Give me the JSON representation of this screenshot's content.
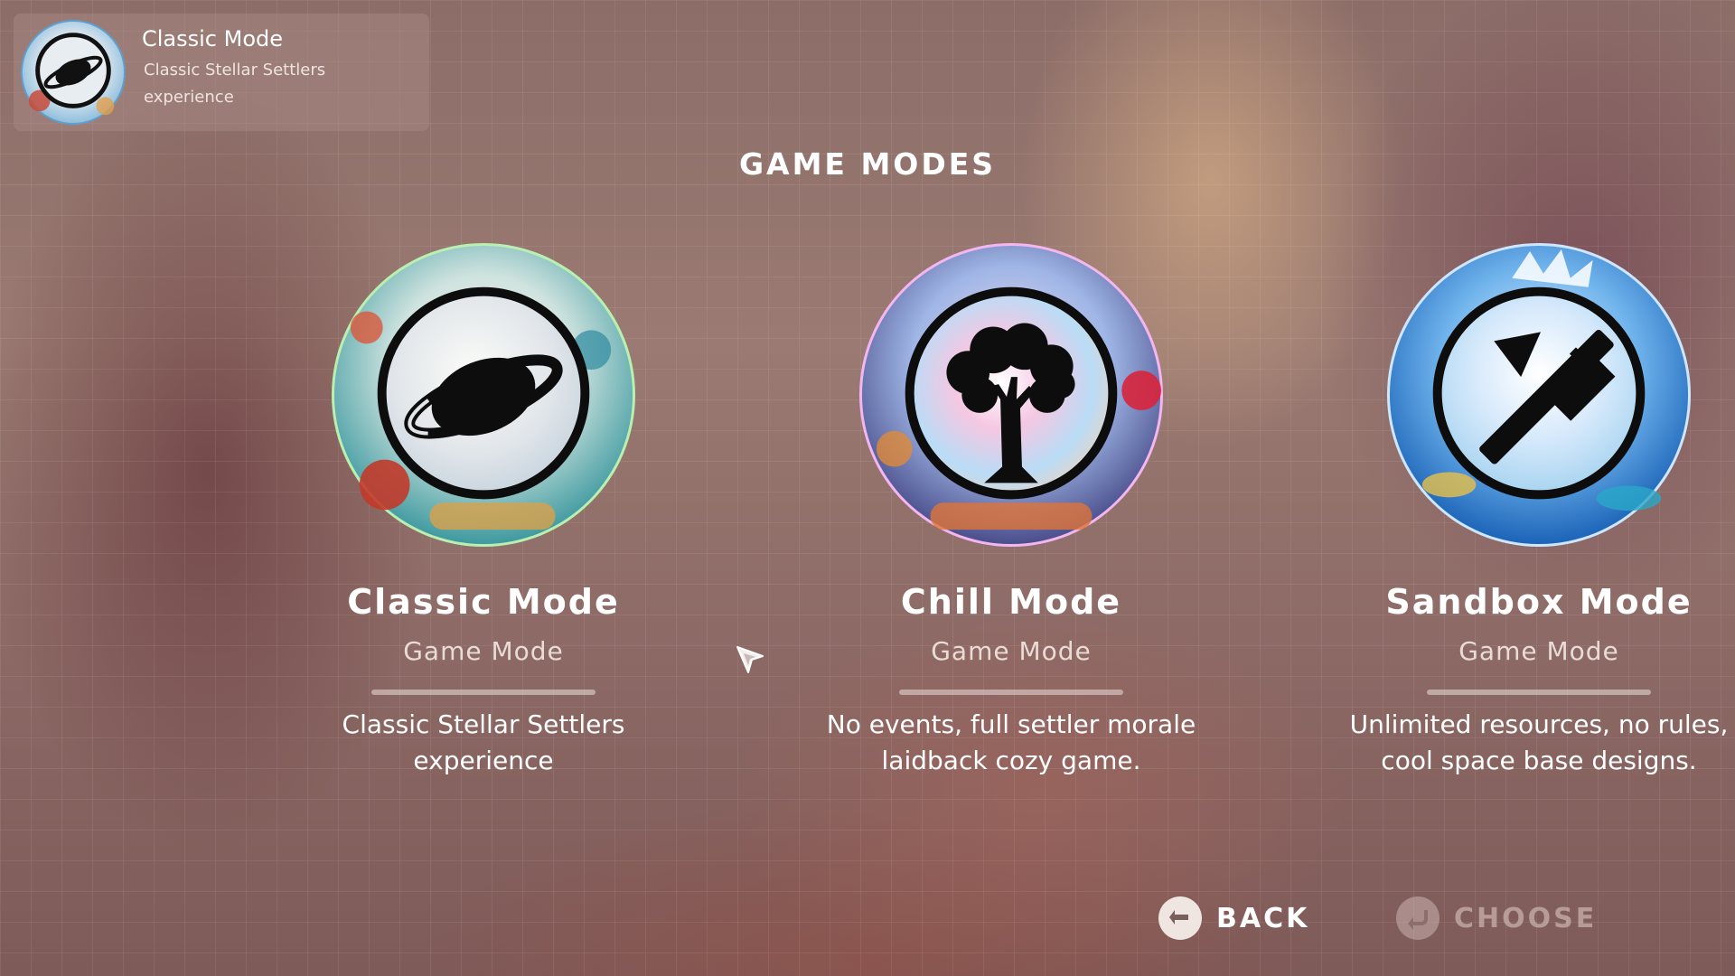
{
  "current_selection": {
    "title": "Classic Mode",
    "description": "Classic Stellar Settlers experience",
    "icon": "planet-icon"
  },
  "screen_title": "GAME MODES",
  "modes": [
    {
      "name": "Classic Mode",
      "type": "Game Mode",
      "description": "Classic Stellar Settlers experience",
      "icon": "planet-icon",
      "ring_color": "#b9f0b0"
    },
    {
      "name": "Chill Mode",
      "type": "Game Mode",
      "description": "No events, full settler morale laidback cozy game.",
      "icon": "tree-icon",
      "ring_color": "#f4b6f0"
    },
    {
      "name": "Sandbox Mode",
      "type": "Game Mode",
      "description": "Unlimited resources, no rules, cool space base designs.",
      "icon": "hammer-icon",
      "ring_color": "#cfe6ff"
    }
  ],
  "actions": {
    "back_label": "BACK",
    "back_icon": "arrow-left-icon",
    "choose_label": "CHOOSE",
    "choose_icon": "enter-arrow-icon",
    "choose_enabled": false
  }
}
